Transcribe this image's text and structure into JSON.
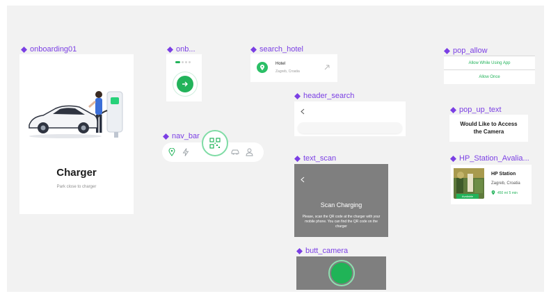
{
  "colors": {
    "accent": "#7b3fe4",
    "green": "#22b35a",
    "gray_panel": "#7f7f7f"
  },
  "components": {
    "onboarding01": {
      "label": "onboarding01",
      "title": "Charger",
      "subtitle": "Park close to charger"
    },
    "onb": {
      "label": "onb..."
    },
    "nav_bar": {
      "label": "nav_bar"
    },
    "search_hotel": {
      "label": "search_hotel",
      "name": "Hotel",
      "location": "Zagreb, Croatia"
    },
    "header_search": {
      "label": "header_search"
    },
    "text_scan": {
      "label": "text_scan",
      "title": "Scan Charging",
      "body": "Please, scan the QR code at the charger with your mobile phone. You can find the QR code on the charger"
    },
    "butt_camera": {
      "label": "butt_camera"
    },
    "pop_allow": {
      "label": "pop_allow",
      "option1": "Allow While Using App",
      "option2": "Allow Once"
    },
    "pop_up_text": {
      "label": "pop_up_text",
      "text": "Would Like to Access the Camera"
    },
    "hp_station": {
      "label": "HP_Station_Avalia...",
      "name": "HP Station",
      "location": "Zagreb, Croatia",
      "badge": "Available",
      "distance": "450 m/ 5 min"
    }
  }
}
